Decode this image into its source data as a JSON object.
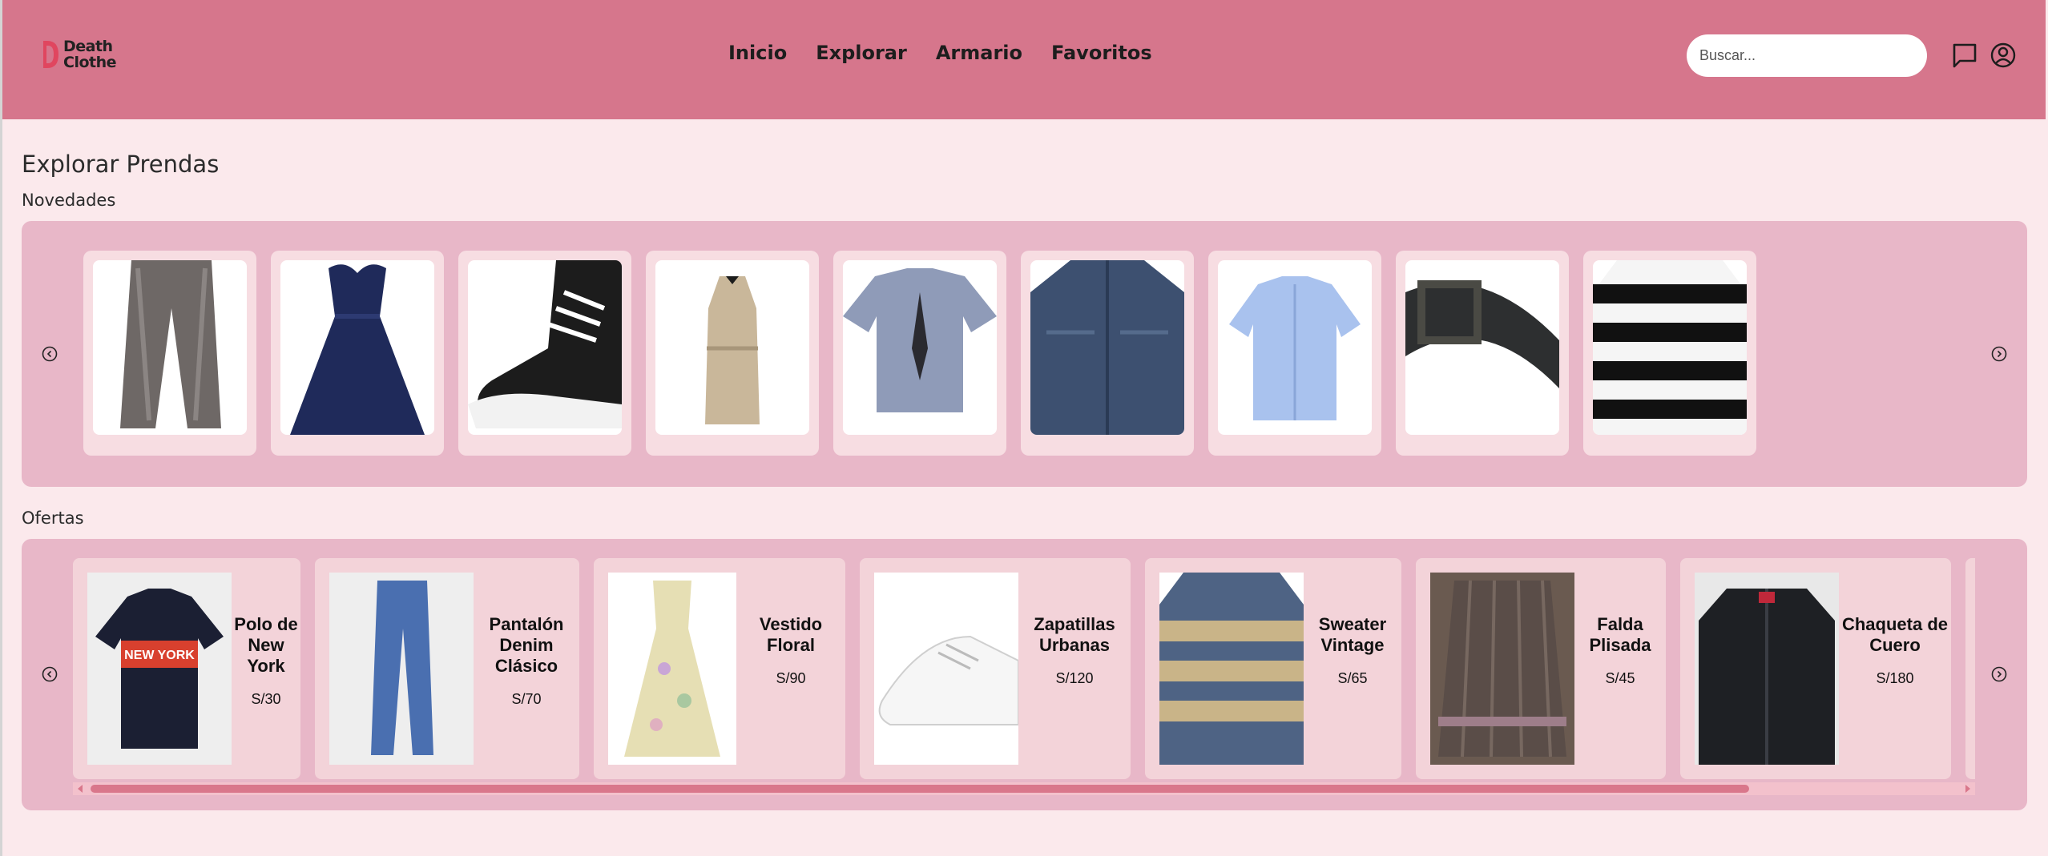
{
  "brand": {
    "name_line1": "Death",
    "name_line2": "Clothe"
  },
  "nav": [
    {
      "label": "Inicio"
    },
    {
      "label": "Explorar"
    },
    {
      "label": "Armario"
    },
    {
      "label": "Favoritos"
    }
  ],
  "search": {
    "placeholder": "Buscar...",
    "value": ""
  },
  "header_icons": [
    "chat-icon",
    "user-account-icon"
  ],
  "page_title": "Explorar Prendas",
  "novedades": {
    "label": "Novedades",
    "items": [
      {
        "image": "wide-leg-gray-jeans"
      },
      {
        "image": "navy-sweetheart-gown"
      },
      {
        "image": "black-high-top-sneaker"
      },
      {
        "image": "beige-trench-coat"
      },
      {
        "image": "tie-dye-graphic-shirt"
      },
      {
        "image": "denim-jacket"
      },
      {
        "image": "light-blue-button-shirt"
      },
      {
        "image": "black-leather-belt"
      },
      {
        "image": "black-white-striped-sweater"
      }
    ]
  },
  "ofertas": {
    "label": "Ofertas",
    "items": [
      {
        "name": "Polo de New York",
        "price": "S/30",
        "image": "navy-polo",
        "print": "NEW YORK"
      },
      {
        "name": "Pantalón Denim Clásico",
        "price": "S/70",
        "image": "blue-jeans"
      },
      {
        "name": "Vestido Floral",
        "price": "S/90",
        "image": "floral-dress"
      },
      {
        "name": "Zapatillas Urbanas",
        "price": "S/120",
        "image": "white-sneaker"
      },
      {
        "name": "Sweater Vintage",
        "price": "S/65",
        "image": "patterned-sweater"
      },
      {
        "name": "Falda Plisada",
        "price": "S/45",
        "image": "pleated-skirt"
      },
      {
        "name": "Chaqueta de Cuero",
        "price": "S/180",
        "image": "leather-jacket"
      }
    ]
  },
  "colors": {
    "header": "#d6768c",
    "background": "#fbe9ec",
    "panel": "#e8b7c8",
    "card": "#f7dde2",
    "logo_accent": "#e0465f"
  }
}
